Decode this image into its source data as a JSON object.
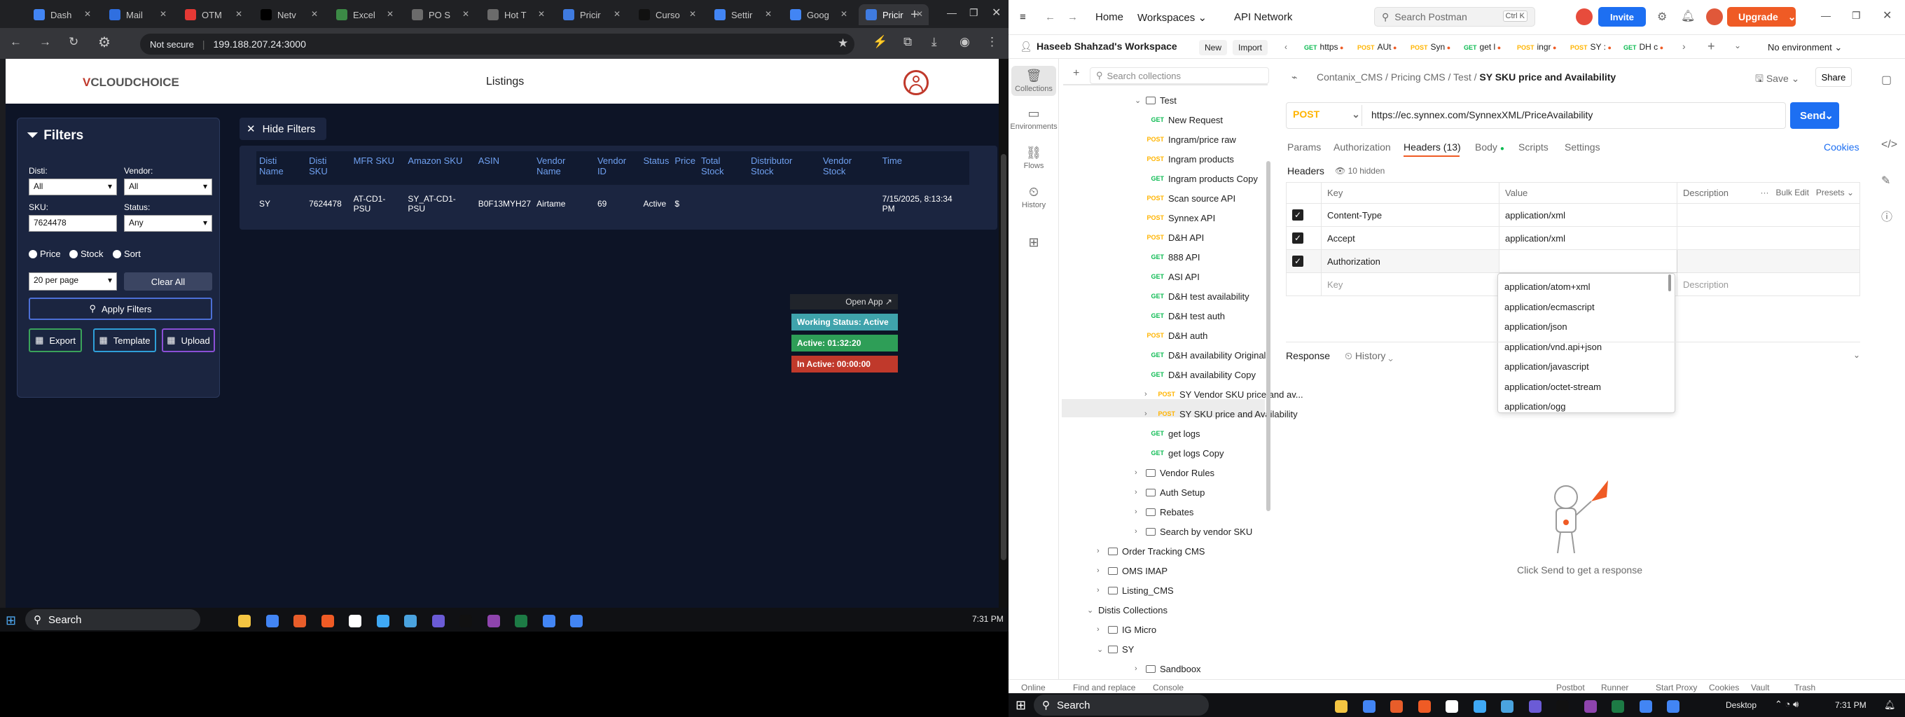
{
  "chrome": {
    "tabs": [
      {
        "label": "Dash",
        "color": "#4285f4"
      },
      {
        "label": "Mail",
        "color": "#2f6fe0"
      },
      {
        "label": "OTM",
        "color": "#e53935"
      },
      {
        "label": "Netv",
        "color": "#000000"
      },
      {
        "label": "Excel",
        "color": "#3c8a46"
      },
      {
        "label": "PO S",
        "color": "#6b6b6b"
      },
      {
        "label": "Hot T",
        "color": "#6b6b6b"
      },
      {
        "label": "Pricir",
        "color": "#3f7be0"
      },
      {
        "label": "Curso",
        "color": "#111111"
      },
      {
        "label": "Settir",
        "color": "#4285f4"
      },
      {
        "label": "Goog",
        "color": "#4285f4"
      },
      {
        "label": "Pricir",
        "color": "#3f7be0"
      }
    ],
    "security_label": "Not secure",
    "url": "199.188.207.24:3000"
  },
  "app": {
    "logo_a": "V",
    "logo_b": "CLOUDCHOICE",
    "title": "Listings",
    "filters": {
      "heading": "Filters",
      "disti_label": "Disti:",
      "disti_value": "All",
      "vendor_label": "Vendor:",
      "vendor_value": "All",
      "sku_label": "SKU:",
      "sku_value": "7624478",
      "status_label": "Status:",
      "status_value": "Any",
      "radio_price": "Price",
      "radio_stock": "Stock",
      "radio_sort": "Sort",
      "per_page": "20 per page",
      "clear_all": "Clear All",
      "apply": "Apply Filters",
      "export": "Export",
      "template": "Template",
      "upload": "Upload"
    },
    "hide_filters": "Hide Filters",
    "table": {
      "headers": [
        "Disti Name",
        "Disti SKU",
        "MFR SKU",
        "Amazon SKU",
        "ASIN",
        "Vendor Name",
        "Vendor ID",
        "Status",
        "Price",
        "Total Stock",
        "Distributor Stock",
        "Vendor Stock",
        "Time"
      ],
      "row": [
        "SY",
        "7624478",
        "AT-CD1-PSU",
        "SY_AT-CD1-PSU",
        "B0F13MYH27",
        "Airtame",
        "69",
        "Active",
        "$",
        "",
        "",
        "",
        "7/15/2025, 8:13:34 PM"
      ]
    },
    "status_widget": {
      "open_app": "Open App ↗",
      "working": "Working Status: Active",
      "active": "Active: 01:32:20",
      "inactive": "In Active: 00:00:00"
    }
  },
  "taskbar": {
    "search": "Search",
    "time": "7:31 PM",
    "desktop": "Desktop"
  },
  "postman": {
    "nav": {
      "home": "Home",
      "workspaces": "Workspaces",
      "api_network": "API Network"
    },
    "search_placeholder": "Search Postman",
    "shortcut": "Ctrl K",
    "invite": "Invite",
    "upgrade": "Upgrade",
    "workspace_name": "Haseeb Shahzad's Workspace",
    "new_btn": "New",
    "import_btn": "Import",
    "sidebar": [
      "Collections",
      "Environments",
      "Flows",
      "History"
    ],
    "collection_search": "Search collections",
    "tree": [
      {
        "m": "",
        "t": "Test",
        "lvl": 2,
        "type": "folder-open"
      },
      {
        "m": "GET",
        "t": "New Request",
        "lvl": 3
      },
      {
        "m": "POST",
        "t": "Ingram/price raw",
        "lvl": 3
      },
      {
        "m": "POST",
        "t": "Ingram products",
        "lvl": 3
      },
      {
        "m": "GET",
        "t": "Ingram products Copy",
        "lvl": 3
      },
      {
        "m": "POST",
        "t": "Scan source API",
        "lvl": 3
      },
      {
        "m": "POST",
        "t": "Synnex API",
        "lvl": 3
      },
      {
        "m": "POST",
        "t": "D&H API",
        "lvl": 3
      },
      {
        "m": "GET",
        "t": "888 API",
        "lvl": 3
      },
      {
        "m": "GET",
        "t": "ASI API",
        "lvl": 3
      },
      {
        "m": "GET",
        "t": "D&H test availability",
        "lvl": 3
      },
      {
        "m": "GET",
        "t": "D&H test auth",
        "lvl": 3
      },
      {
        "m": "POST",
        "t": "D&H auth",
        "lvl": 3
      },
      {
        "m": "GET",
        "t": "D&H availability Original",
        "lvl": 3
      },
      {
        "m": "GET",
        "t": "D&H availability Copy",
        "lvl": 3
      },
      {
        "m": "POST",
        "t": "SY Vendor SKU price and av...",
        "lvl": 3,
        "type": "chev"
      },
      {
        "m": "POST",
        "t": "SY SKU price and Availability",
        "lvl": 3,
        "type": "chev"
      },
      {
        "m": "GET",
        "t": "get logs",
        "lvl": 3
      },
      {
        "m": "GET",
        "t": "get logs Copy",
        "lvl": 3
      },
      {
        "m": "",
        "t": "Vendor Rules",
        "lvl": 2,
        "type": "folder"
      },
      {
        "m": "",
        "t": "Auth Setup",
        "lvl": 2,
        "type": "folder"
      },
      {
        "m": "",
        "t": "Rebates",
        "lvl": 2,
        "type": "folder"
      },
      {
        "m": "",
        "t": "Search by vendor SKU",
        "lvl": 2,
        "type": "folder"
      },
      {
        "m": "",
        "t": "Order Tracking CMS",
        "lvl": 1,
        "type": "folder"
      },
      {
        "m": "",
        "t": "OMS IMAP",
        "lvl": 1,
        "type": "folder"
      },
      {
        "m": "",
        "t": "Listing_CMS",
        "lvl": 1,
        "type": "folder"
      },
      {
        "m": "",
        "t": "Distis Collections",
        "lvl": 0,
        "type": "open"
      },
      {
        "m": "",
        "t": "IG Micro",
        "lvl": 1,
        "type": "folder"
      },
      {
        "m": "",
        "t": "SY",
        "lvl": 1,
        "type": "folder-open"
      },
      {
        "m": "",
        "t": "Sandboox",
        "lvl": 2,
        "type": "folder"
      }
    ],
    "req_tabs": [
      {
        "m": "GET",
        "t": "https"
      },
      {
        "m": "POST",
        "t": "AUt"
      },
      {
        "m": "POST",
        "t": "Syn"
      },
      {
        "m": "GET",
        "t": "get l"
      },
      {
        "m": "POST",
        "t": "ingr"
      },
      {
        "m": "POST",
        "t": "SY :"
      },
      {
        "m": "GET",
        "t": "DH c"
      }
    ],
    "environment": "No environment",
    "breadcrumb": [
      "Contanix_CMS",
      "Pricing CMS",
      "Test"
    ],
    "request_title": "SY SKU price and Availability",
    "save": "Save",
    "share": "Share",
    "method": "POST",
    "url": "https://ec.synnex.com/SynnexXML/PriceAvailability",
    "send": "Send",
    "req_sections": [
      "Params",
      "Authorization",
      "Headers (13)",
      "Body",
      "Scripts",
      "Settings"
    ],
    "cookies": "Cookies",
    "headers_label": "Headers",
    "hidden": "10 hidden",
    "cols": [
      "Key",
      "Value",
      "Description",
      "Bulk Edit",
      "Presets"
    ],
    "rows": [
      {
        "key": "Content-Type",
        "value": "application/xml"
      },
      {
        "key": "Accept",
        "value": "application/xml"
      },
      {
        "key": "Authorization",
        "value": ""
      }
    ],
    "placeholder_key": "Key",
    "placeholder_desc": "Description",
    "dropdown": [
      "application/atom+xml",
      "application/ecmascript",
      "application/json",
      "application/vnd.api+json",
      "application/javascript",
      "application/octet-stream",
      "application/ogg"
    ],
    "response": "Response",
    "history": "History",
    "click_send": "Click Send to get a response",
    "footer": [
      "Online",
      "Find and replace",
      "Console",
      "Postbot",
      "Runner",
      "Start Proxy",
      "Cookies",
      "Vault",
      "Trash"
    ]
  }
}
